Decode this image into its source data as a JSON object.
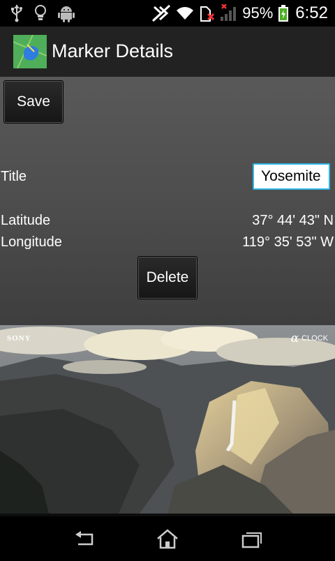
{
  "status_bar": {
    "battery_percent": "95%",
    "time": "6:52",
    "icons": [
      "usb-icon",
      "lightbulb-icon",
      "android-icon",
      "nfc-off-icon",
      "wifi-icon",
      "sim-error-icon",
      "signal-icon",
      "battery-charging-icon"
    ]
  },
  "action_bar": {
    "title": "Marker Details",
    "icon": "map-app-icon"
  },
  "form": {
    "save_label": "Save",
    "title_label": "Title",
    "title_value": "Yosemite",
    "latitude_label": "Latitude",
    "latitude_value": "37° 44' 43\" N",
    "longitude_label": "Longitude",
    "longitude_value": "119° 35' 53\" W",
    "delete_label": "Delete"
  },
  "photo": {
    "brand": "SONY",
    "watermark": "α",
    "watermark_sub": "CLOCK"
  },
  "nav_bar": {
    "icons": [
      "back-icon",
      "home-icon",
      "recent-apps-icon"
    ]
  }
}
